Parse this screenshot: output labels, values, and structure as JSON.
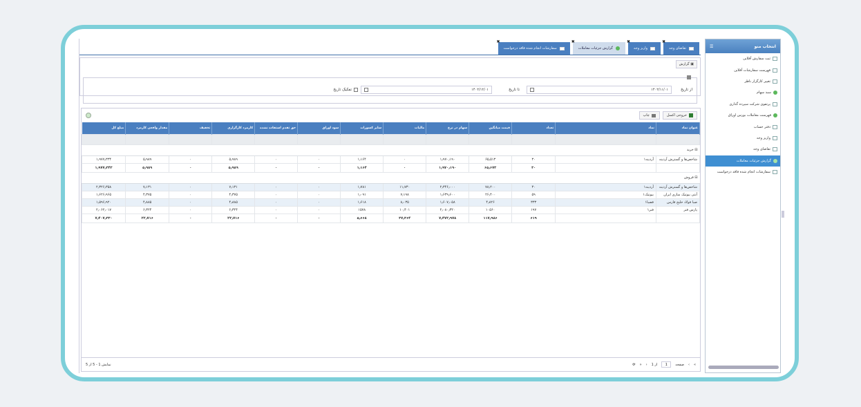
{
  "sidebar": {
    "title": "انتخاب منو",
    "items": [
      {
        "label": "ثبت سفارش آفلاین",
        "icon": "doc"
      },
      {
        "label": "فهرست سفارشات آفلاین",
        "icon": "doc"
      },
      {
        "label": "تغییر کارگزار ناظر",
        "icon": "doc"
      },
      {
        "label": "سبد سهام",
        "icon": "ok"
      },
      {
        "label": "پرتفوی شرکت سپرده گذاری",
        "icon": "doc"
      },
      {
        "label": "فهرست معاملات بورس اوراق",
        "icon": "ok"
      },
      {
        "label": "دفتر حساب",
        "icon": "doc"
      },
      {
        "label": "واریز وجه",
        "icon": "doc"
      },
      {
        "label": "تقاضای وجه",
        "icon": "doc"
      },
      {
        "label": "گزارش جزئیات معاملات",
        "icon": "ok",
        "active": true
      },
      {
        "label": "سفارشات انجام شده فاقد درخواست",
        "icon": "doc"
      }
    ]
  },
  "tabs": [
    {
      "label": "تقاضای وجه"
    },
    {
      "label": "واریز وجه"
    },
    {
      "label": "گزارش جزئیات معاملات",
      "active": true
    },
    {
      "label": "سفارشات انجام شده فاقد درخواست"
    }
  ],
  "panel": {
    "report_button": "گزارش",
    "from_date_label": "از تاریخ",
    "from_date_value": "۱۴۰۲/۱۱/۰۱",
    "to_date_label": "تا تاریخ",
    "to_date_value": "۱۴۰۲/۱۲/۰۱",
    "separate_date_label": "تفکیک تاریخ"
  },
  "toolbar": {
    "excel": "خروجی اکسل",
    "print": "چاپ"
  },
  "columns": [
    "عنوان نماد",
    "نماد",
    "تعداد",
    "قیمت میانگین",
    "سهام در نرخ",
    "مالیات",
    "سایر کسورات",
    "سود اوراق",
    "حق تقدم استفاده نشده",
    "کارمزد کارگزاری",
    "تخفیف",
    "مقدار واقعی کارمزد",
    "مبلغ کل"
  ],
  "groups": [
    {
      "title": "خرید",
      "rows": [
        [
          "شاخص‌ها و گسترش آردینه",
          "آردینه۱",
          "۳۰",
          "۶۵٫۵۱۳",
          "۱٫۹۷۰٫۱۹۰",
          "۰",
          "۱٫۱۶۴",
          "۰",
          "۰",
          "۵٫۹۸۹",
          "۰",
          "۵٫۹۸۹",
          "۱٫۹۷۷٫۳۳۴"
        ]
      ],
      "total": [
        "",
        "",
        "۳۰",
        "۶۵٫۶۷۳",
        "۱٫۹۷۰٫۱۹۰",
        "۰",
        "۱٫۱۶۴",
        "۰",
        "۰",
        "۵٫۹۸۹",
        "۰",
        "۵٫۹۸۹",
        "۱٫۹۷۷٫۳۴۳"
      ]
    },
    {
      "title": "فروش",
      "rows": [
        [
          "شاخص‌ها و گسترش آردینه",
          "آردینه۱",
          "۳۰",
          "۷۸٫۲۰۰",
          "۲٫۳۴۶٫۰۰۰",
          "۱۱٫۷۳۰",
          "۱٫۷۸۱",
          "۰",
          "۰",
          "۷٫۱۳۱",
          "۰",
          "۷٫۱۳۱",
          "۲٫۳۲۶٫۳۵۸"
        ],
        [
          "آنتی بیوتیک سازی ایران",
          "بیوتیک۱",
          "۵۹",
          "۲۶٫۴۰۰",
          "۱٫۶۳۹٫۶۰۰",
          "۷٫۱۹۸",
          "۱٫۰۹۱",
          "۰",
          "۰",
          "۴٫۳۷۵",
          "۰",
          "۴٫۳۷۵",
          "۱٫۶۲۶٫۹۶۵"
        ],
        [
          "صبا فولاد خلیج فارس",
          "فصبا۱",
          "۳۳۳",
          "۴٫۸۲۶",
          "۱٫۶۰۷٫۰۵۸",
          "۸٫۰۳۵",
          "۱٫۶۱۸",
          "۰",
          "۰",
          "۴٫۸۸۵",
          "۰",
          "۴٫۸۸۵",
          "۱٫۵۹۶٫۹۲۰"
        ],
        [
          "پارس فنر",
          "فنر۱",
          "۱۹۷",
          "۱۰۵۶۰",
          "۲٫۰۸۰٫۳۲۰",
          "۱۰٫۴۰۱",
          "۱۵۷۸",
          "۰",
          "۰",
          "۶٫۳۲۴",
          "۰",
          "۶٫۳۲۴",
          "۲٫۰۶۲٫۰۱۷"
        ]
      ],
      "total": [
        "",
        "",
        "۶۱۹",
        "۱۱۷٫۹۸۶",
        "۷٫۴۷۲٫۹۷۸",
        "۳۷٫۳۶۴",
        "۵٫۶۶۸",
        "۰",
        "۰",
        "۲۲٫۷۱۶",
        "۰",
        "۲۲٫۷۱۶",
        "۷٫۴۰۷٫۳۳۰"
      ]
    }
  ],
  "pager": {
    "page_label": "صفحه",
    "page_value": "1",
    "of_label": "از 1",
    "info": "نمایش 1 - 5 از 5"
  }
}
